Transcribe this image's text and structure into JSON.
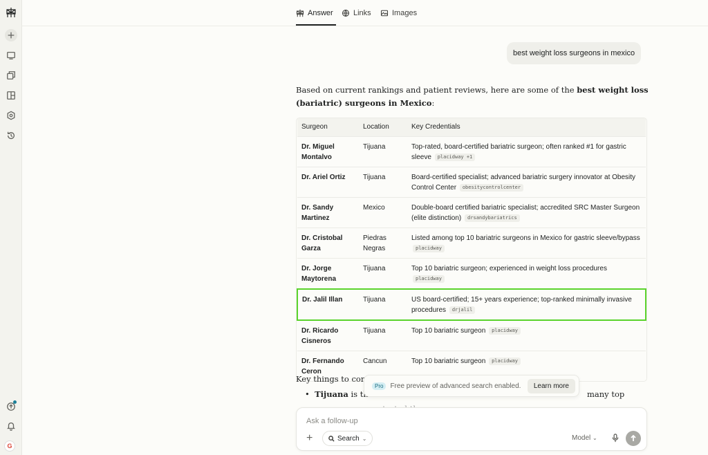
{
  "sidebar": {
    "icons": [
      "perplexity-logo-icon",
      "new-thread-icon",
      "home-icon",
      "spaces-icon",
      "discover-icon",
      "library-icon",
      "history-icon",
      "download-app-icon",
      "notifications-icon",
      "account-avatar-icon"
    ],
    "avatar_letter": "G"
  },
  "tabs": [
    {
      "label": "Answer",
      "icon": "perplexity-logo-icon"
    },
    {
      "label": "Links",
      "icon": "globe-icon"
    },
    {
      "label": "Images",
      "icon": "image-icon"
    }
  ],
  "query": "best weight loss surgeons in mexico",
  "answer": {
    "intro_pre": "Based on current rankings and patient reviews, here are some of the ",
    "intro_bold": "best weight loss (bariatric) surgeons in Mexico",
    "intro_post": ":"
  },
  "table": {
    "headers": [
      "Surgeon",
      "Location",
      "Key Credentials"
    ],
    "rows": [
      {
        "surgeon": "Dr. Miguel Montalvo",
        "location": "Tijuana",
        "credentials": "Top-rated, board-certified bariatric surgeon; often ranked #1 for gastric sleeve",
        "source": "placidway +1"
      },
      {
        "surgeon": "Dr. Ariel Ortiz",
        "location": "Tijuana",
        "credentials": "Board-certified specialist; advanced bariatric surgery innovator at Obesity Control Center",
        "source": "obesitycontrolcenter"
      },
      {
        "surgeon": "Dr. Sandy Martinez",
        "location": "Mexico",
        "credentials": "Double-board certified bariatric specialist; accredited SRC Master Surgeon (elite distinction)",
        "source": "drsandybariatrics"
      },
      {
        "surgeon": "Dr. Cristobal Garza",
        "location": "Piedras Negras",
        "credentials": "Listed among top 10 bariatric surgeons in Mexico for gastric sleeve/bypass",
        "source": "placidway"
      },
      {
        "surgeon": "Dr. Jorge Maytorena",
        "location": "Tijuana",
        "credentials": "Top 10 bariatric surgeon; experienced in weight loss procedures",
        "source": "placidway"
      },
      {
        "surgeon": "Dr. Jalil Illan",
        "location": "Tijuana",
        "credentials": "US board-certified; 15+ years experience; top-ranked minimally invasive procedures",
        "source": "drjalil"
      },
      {
        "surgeon": "Dr. Ricardo Cisneros",
        "location": "Tijuana",
        "credentials": "Top 10 bariatric surgeon",
        "source": "placidway"
      },
      {
        "surgeon": "Dr. Fernando Ceron",
        "location": "Cancun",
        "credentials": "Top 10 bariatric surgeon",
        "source": "placidway"
      }
    ]
  },
  "key_things": {
    "heading": "Key things to cons",
    "bullet_bold": "Tijuana",
    "bullet_start": " is the",
    "bullet_end": "many top",
    "bullet_line2": "surgeons concentrated there"
  },
  "toast": {
    "badge": "Pro",
    "text": "Free preview of advanced search enabled.",
    "button": "Learn more"
  },
  "composer": {
    "placeholder": "Ask a follow-up",
    "search_label": "Search",
    "model_label": "Model"
  }
}
